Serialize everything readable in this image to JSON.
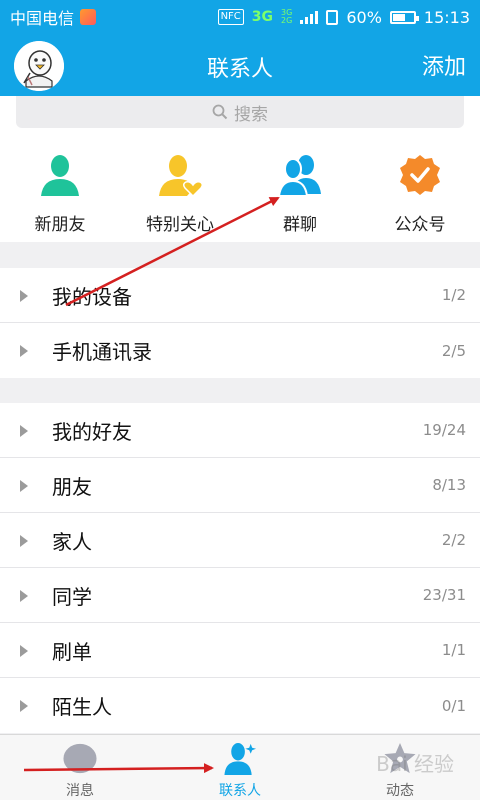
{
  "status_bar": {
    "carrier": "中国电信",
    "nfc": "NFC",
    "network": "3G",
    "network_small_top": "3G",
    "network_small_bottom": "2G",
    "battery": "60%",
    "time": "15:13"
  },
  "header": {
    "title": "联系人",
    "add_label": "添加"
  },
  "search": {
    "placeholder": "搜索"
  },
  "quick_entries": [
    {
      "label": "新朋友",
      "icon": "person-icon",
      "color": "#1fc39a"
    },
    {
      "label": "特别关心",
      "icon": "person-heart-icon",
      "color": "#f7c52a"
    },
    {
      "label": "群聊",
      "icon": "group-icon",
      "color": "#12a5e6"
    },
    {
      "label": "公众号",
      "icon": "badge-check-icon",
      "color": "#f48a2a"
    }
  ],
  "groups_top": [
    {
      "label": "我的设备",
      "count": "1/2"
    },
    {
      "label": "手机通讯录",
      "count": "2/5"
    }
  ],
  "groups_main": [
    {
      "label": "我的好友",
      "count": "19/24"
    },
    {
      "label": "朋友",
      "count": "8/13"
    },
    {
      "label": "家人",
      "count": "2/2"
    },
    {
      "label": "同学",
      "count": "23/31"
    },
    {
      "label": "刷单",
      "count": "1/1"
    },
    {
      "label": "陌生人",
      "count": "0/1"
    }
  ],
  "tabbar": {
    "tabs": [
      {
        "label": "消息",
        "icon": "message-icon",
        "active": false
      },
      {
        "label": "联系人",
        "icon": "contacts-icon",
        "active": true
      },
      {
        "label": "动态",
        "icon": "star-icon",
        "active": false
      }
    ]
  },
  "watermark": "Bai 经验",
  "colors": {
    "brand": "#12a5e6",
    "annotation_arrow": "#d42020"
  }
}
